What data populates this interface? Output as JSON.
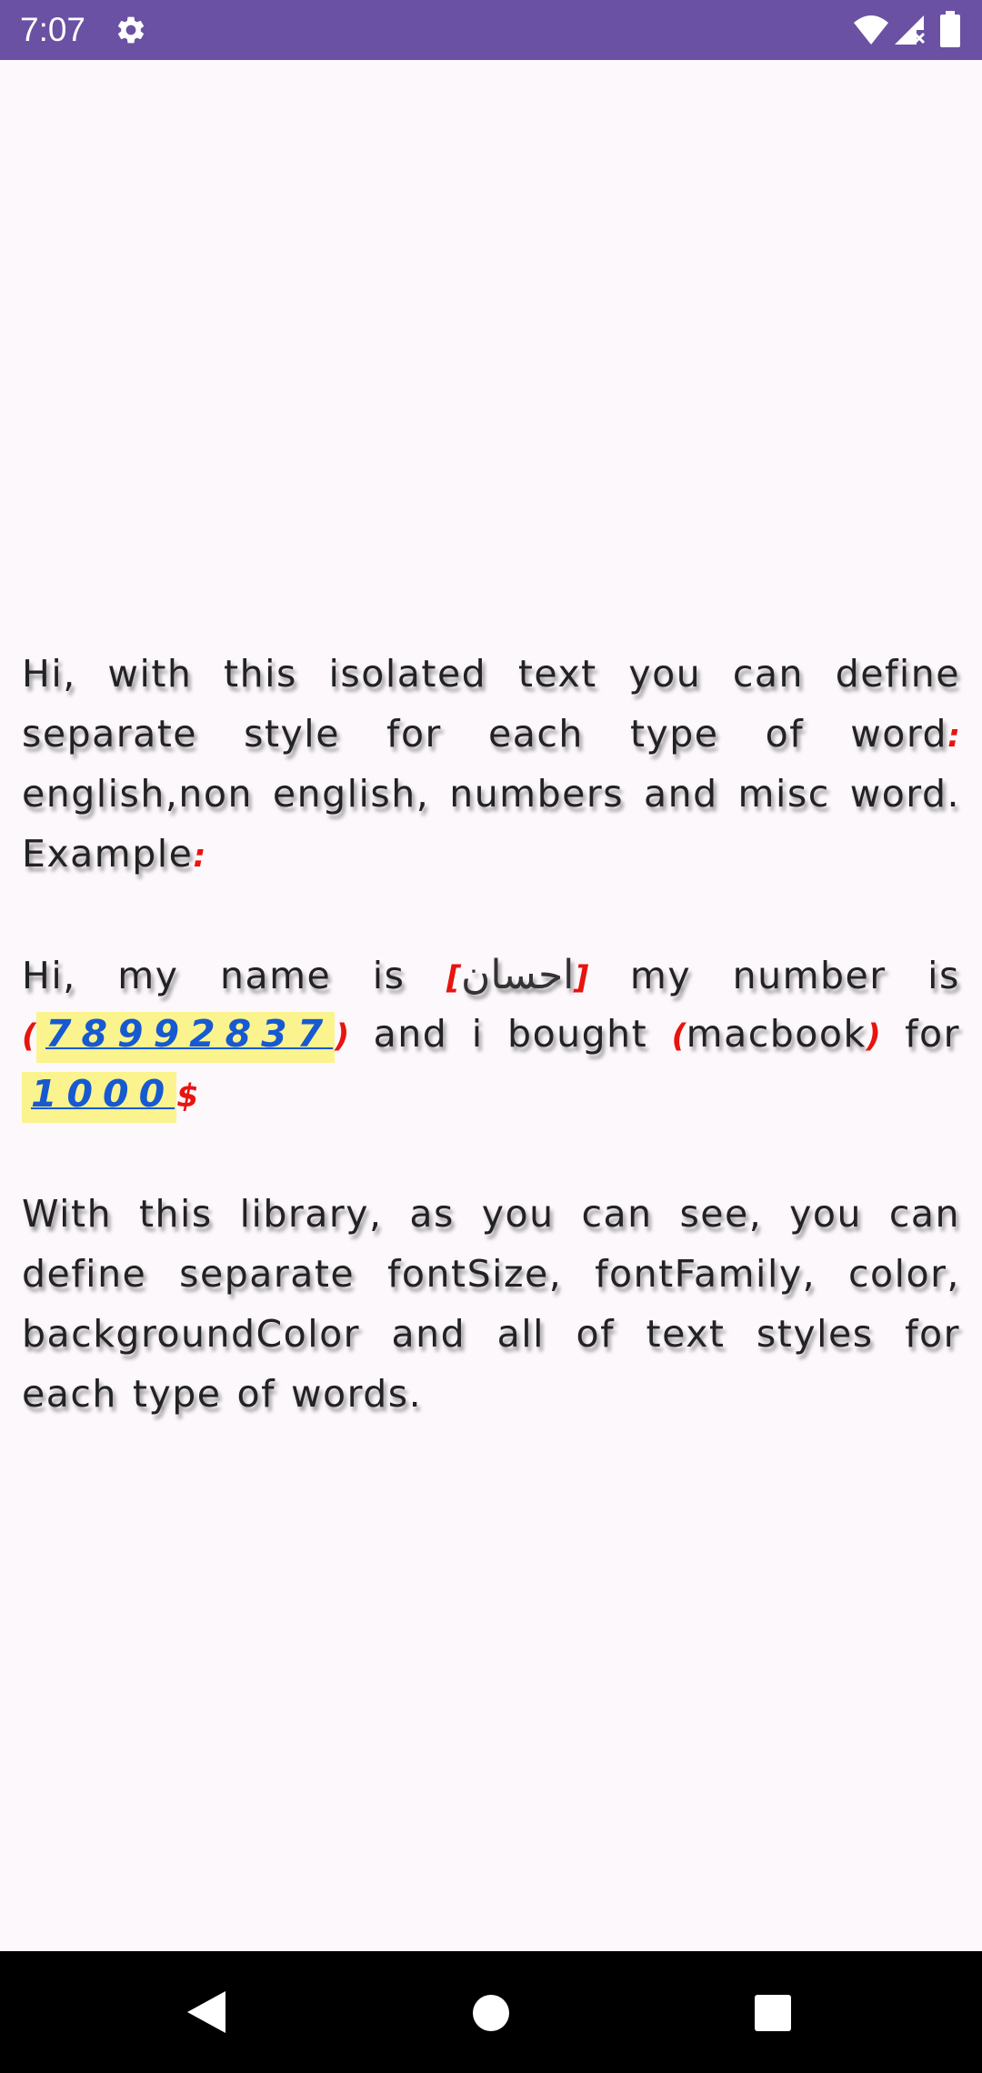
{
  "status_bar": {
    "time": "7:07",
    "icons": [
      "gear-icon",
      "wifi-icon",
      "signal-icon",
      "battery-icon"
    ],
    "background": "#6a51a3"
  },
  "paragraph1": {
    "lines": [
      [
        "Hi,",
        "with",
        "this",
        "isolated",
        "text",
        "you",
        "can",
        "define"
      ],
      [
        "separate",
        "style",
        "for",
        "each",
        "type",
        "of",
        "word"
      ],
      [
        "english",
        "non",
        "english,",
        "numbers",
        "and",
        "misc",
        "word."
      ]
    ],
    "colon_after_word": ":",
    "comma_misc": ",",
    "last_line": "Example",
    "example_colon": ":"
  },
  "paragraph2": {
    "line1": [
      "Hi,",
      "my",
      "name",
      "is",
      "my",
      "number",
      "is"
    ],
    "bracket_open": "[",
    "arabic_name": "احسان",
    "bracket_close": "]",
    "paren_open": "(",
    "phone_number": "78992837",
    "paren_close": ")",
    "line2_words": [
      "and",
      "i",
      "bought"
    ],
    "product": "macbook",
    "for_word": "for",
    "price": "1000",
    "currency": "$"
  },
  "paragraph3": {
    "lines": [
      [
        "With",
        "this",
        "library,",
        "as",
        "you",
        "can",
        "see,",
        "you",
        "can"
      ],
      [
        "define",
        "separate",
        "fontSize,",
        "fontFamily,",
        "color,"
      ],
      [
        "backgroundColor",
        "and",
        "all",
        "of",
        "text",
        "styles",
        "for"
      ],
      [
        "each",
        "type",
        "of",
        "words."
      ]
    ]
  },
  "nav_bar": {
    "buttons": [
      "back-icon",
      "home-icon",
      "recents-icon"
    ]
  },
  "colors": {
    "misc": "#e8140e",
    "number": "#1659d1",
    "number_background": "#fbf38d"
  }
}
